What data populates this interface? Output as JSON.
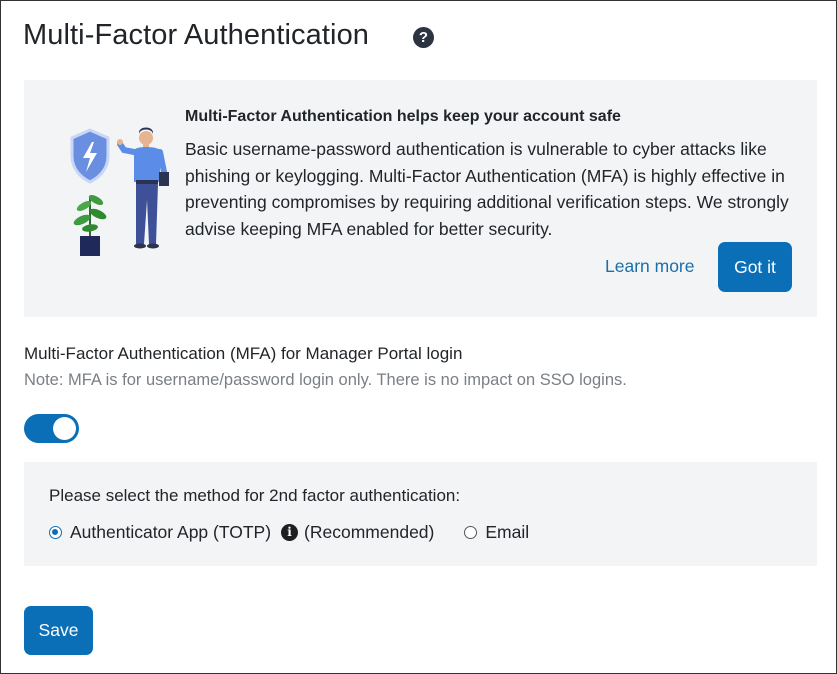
{
  "page": {
    "title": "Multi-Factor Authentication",
    "help_icon": "question-circle-icon"
  },
  "banner": {
    "illustration": "security-person-illustration",
    "heading": "Multi-Factor Authentication helps keep your account safe",
    "body": "Basic username-password authentication is vulnerable to cyber attacks like phishing or keylogging. Multi-Factor Authentication (MFA) is highly effective in preventing compromises by requiring additional verification steps. We strongly advise keeping MFA enabled for better security.",
    "learn_more": "Learn more",
    "got_it": "Got it"
  },
  "mfa": {
    "label": "Multi-Factor Authentication (MFA) for Manager Portal login",
    "note": "Note: MFA is for username/password login only. There is no impact on SSO logins.",
    "enabled": true
  },
  "method": {
    "label": "Please select the method for 2nd factor authentication:",
    "options": [
      {
        "label": "Authenticator App (TOTP)",
        "suffix": "(Recommended)",
        "selected": true
      },
      {
        "label": "Email",
        "selected": false
      }
    ],
    "info_icon": "info-circle-icon"
  },
  "actions": {
    "save": "Save"
  },
  "colors": {
    "primary": "#0a6fb6",
    "link": "#1b6fa8",
    "panel_bg": "#f3f4f6",
    "muted_text": "#7a7f85"
  }
}
